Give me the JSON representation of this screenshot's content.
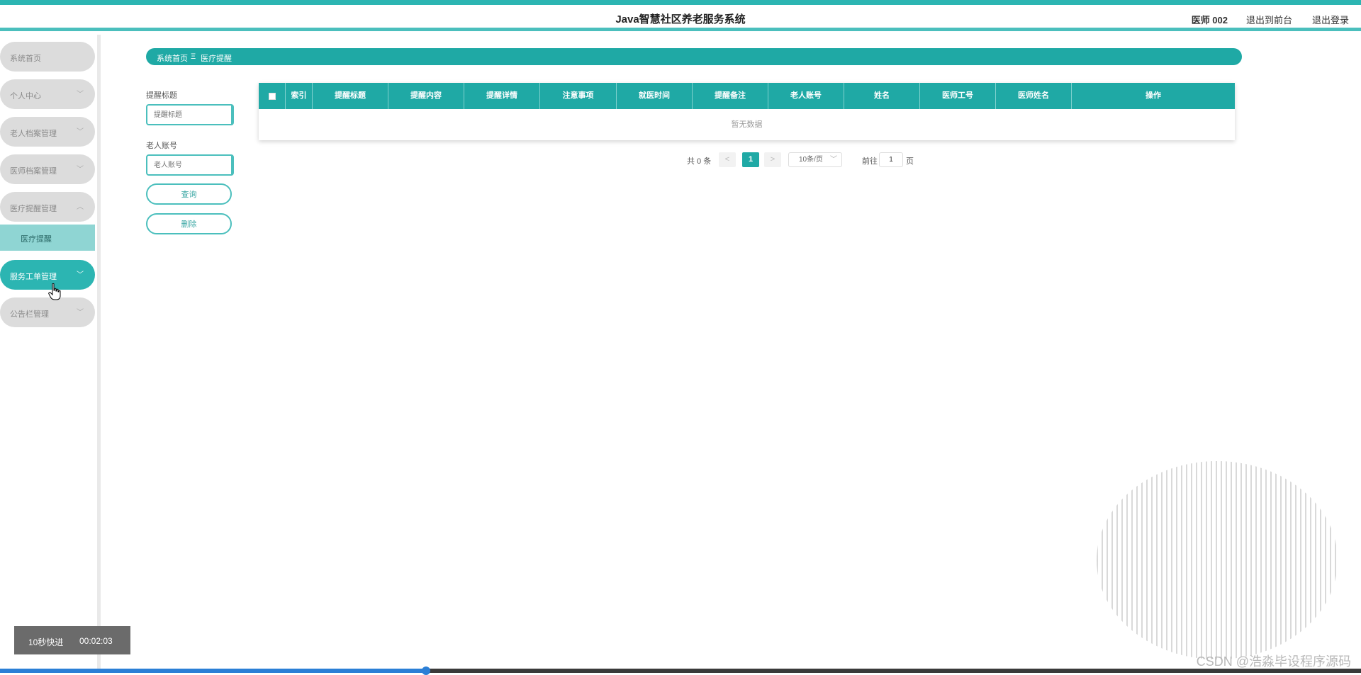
{
  "header": {
    "title": "Java智慧社区养老服务系统",
    "user": "医师 002",
    "front_link": "退出到前台",
    "logout_link": "退出登录"
  },
  "sidebar": {
    "items": [
      {
        "label": "系统首页",
        "chevron": ""
      },
      {
        "label": "个人中心",
        "chevron": "﹀"
      },
      {
        "label": "老人档案管理",
        "chevron": "﹀"
      },
      {
        "label": "医师档案管理",
        "chevron": "﹀"
      },
      {
        "label": "医疗提醒管理",
        "chevron": "︿"
      },
      {
        "label": "服务工单管理",
        "chevron": "﹀"
      },
      {
        "label": "公告栏管理",
        "chevron": "﹀"
      }
    ],
    "submenu_label": "医疗提醒"
  },
  "breadcrumb": {
    "home": "系统首页",
    "separator": "Ξ",
    "current": "医疗提醒"
  },
  "search": {
    "title_label": "提醒标题",
    "title_placeholder": "提醒标题",
    "account_label": "老人账号",
    "account_placeholder": "老人账号",
    "query_button": "查询",
    "delete_button": "删除"
  },
  "table": {
    "columns": [
      "索引",
      "提醒标题",
      "提醒内容",
      "提醒详情",
      "注意事项",
      "就医时间",
      "提醒备注",
      "老人账号",
      "姓名",
      "医师工号",
      "医师姓名",
      "操作"
    ],
    "empty_text": "暂无数据"
  },
  "pagination": {
    "total": "共 0 条",
    "prev": "<",
    "current_page": "1",
    "next": ">",
    "page_size": "10条/页",
    "goto_label": "前往",
    "goto_value": "1",
    "page_suffix": "页"
  },
  "video": {
    "fast_forward": "10秒快进",
    "time": "00:02:03",
    "progress_fraction": 0.313
  },
  "watermark": "CSDN @浩淼毕设程序源码",
  "colors": {
    "primary": "#1fa9a5",
    "accent": "#2cb5b2",
    "submenu": "#8fd5d3"
  }
}
